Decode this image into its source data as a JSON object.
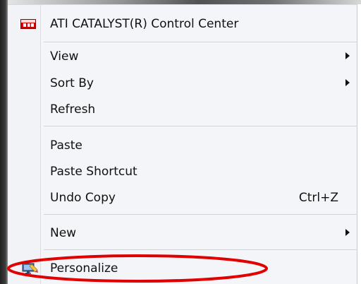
{
  "menu": {
    "items": [
      {
        "label": "ATI CATALYST(R) Control Center",
        "icon": "ati-logo-icon"
      },
      {
        "label": "View",
        "submenu": true
      },
      {
        "label": "Sort By",
        "submenu": true
      },
      {
        "label": "Refresh"
      },
      {
        "label": "Paste"
      },
      {
        "label": "Paste Shortcut"
      },
      {
        "label": "Undo Copy",
        "shortcut": "Ctrl+Z"
      },
      {
        "label": "New",
        "submenu": true
      },
      {
        "label": "Personalize",
        "icon": "personalize-icon"
      }
    ]
  },
  "annotation": {
    "highlight_color": "#e00000",
    "target": "Personalize"
  }
}
